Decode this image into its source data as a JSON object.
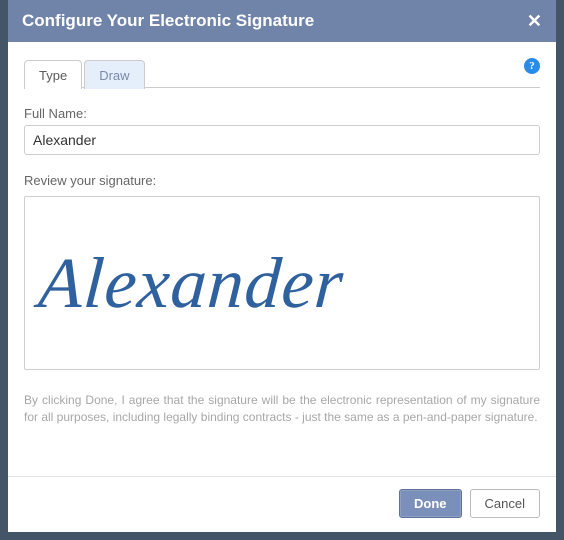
{
  "dialog": {
    "title": "Configure Your Electronic Signature"
  },
  "tabs": {
    "type": "Type",
    "draw": "Draw"
  },
  "labels": {
    "full_name": "Full Name:",
    "review": "Review your signature:"
  },
  "input": {
    "full_name_value": "Alexander"
  },
  "signature": {
    "preview_text": "Alexander",
    "color": "#30619f"
  },
  "disclaimer": "By clicking Done, I agree that the signature will be the electronic representation of my signature for all purposes, including legally binding contracts - just the same as a pen-and-paper signature.",
  "buttons": {
    "done": "Done",
    "cancel": "Cancel"
  },
  "icons": {
    "help": "?",
    "close": "✕"
  }
}
